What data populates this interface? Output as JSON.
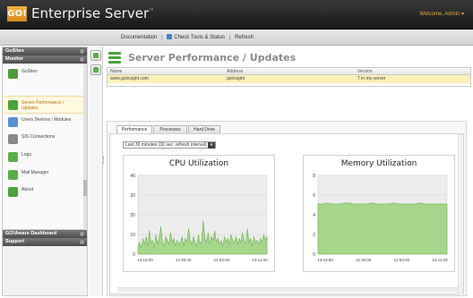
{
  "app": {
    "logo": "GO!",
    "title": "Enterprise Server",
    "tm": "™",
    "welcome": "Welcome, Admin ▾"
  },
  "toolbar": {
    "items": [
      "Documentation",
      "Check Tools & Status",
      "Refresh"
    ]
  },
  "sidebar": {
    "sections": [
      {
        "label": "GoSites",
        "items": []
      },
      {
        "label": "Monitor"
      },
      {
        "label": "GO!Aware Dashboard"
      },
      {
        "label": "Support"
      }
    ],
    "items": [
      {
        "label": "GoSites",
        "icon": "server-icon",
        "color": "#4f9b3b"
      },
      {
        "label": "Server Performance / Updates",
        "icon": "chart-icon",
        "color": "#4aa33b"
      },
      {
        "label": "Users Devices / Modules",
        "icon": "users-icon",
        "color": "#5a8fd0"
      },
      {
        "label": "SIS Connections",
        "icon": "connection-icon",
        "color": "#888888"
      },
      {
        "label": "Logs",
        "icon": "logs-icon",
        "color": "#5cae4b"
      },
      {
        "label": "Mail Manager",
        "icon": "mail-icon",
        "color": "#5cae4b"
      },
      {
        "label": "About",
        "icon": "info-icon",
        "color": "#4aa33b"
      }
    ]
  },
  "page": {
    "title": "Server Performance / Updates"
  },
  "grid": {
    "headers": [
      "Name",
      "Address",
      "Version"
    ],
    "rows": [
      [
        "www.goinsight.com",
        "goinsight",
        "7 in my server"
      ]
    ]
  },
  "tabs": [
    "Performance",
    "Processes",
    "Hard Drive"
  ],
  "range": {
    "value": "Last 30 minutes (30 sec. refresh interval)"
  },
  "colors": {
    "accent": "#4aa33b",
    "chart_fill": "#a6d58c",
    "chart_line": "#6fb352",
    "selected_row": "#fbf0b6"
  },
  "chart_data": [
    {
      "type": "area",
      "title": "CPU Utilization",
      "y_ticks": [
        "40",
        "30",
        "20",
        "10",
        "0"
      ],
      "x_ticks": [
        "12:19:00",
        "12:35:00",
        "12:53:00",
        "13:11:00"
      ],
      "ylim": [
        0,
        40
      ],
      "values": [
        4,
        6,
        3,
        8,
        5,
        9,
        4,
        12,
        6,
        7,
        3,
        10,
        5,
        8,
        14,
        6,
        4,
        9,
        7,
        5,
        11,
        6,
        8,
        4,
        7,
        5,
        6,
        9,
        4,
        8,
        6,
        13,
        7,
        5,
        9,
        6,
        4,
        10,
        5,
        7,
        17,
        8,
        6,
        11,
        5,
        9,
        7,
        12,
        6,
        8,
        5,
        7,
        4,
        9,
        6,
        8,
        5,
        10,
        7,
        6,
        9,
        5,
        8,
        6,
        11,
        7,
        5,
        13,
        6,
        8,
        4,
        9,
        6,
        7,
        5,
        8,
        6,
        10,
        7,
        9
      ]
    },
    {
      "type": "area",
      "title": "Memory Utilization",
      "y_ticks": [
        "8",
        "6",
        "4",
        "2",
        "0"
      ],
      "x_ticks": [
        "12:19:00",
        "12:35:00",
        "12:53:00",
        "13:11:00"
      ],
      "ylim": [
        0,
        8
      ],
      "values": [
        5.1,
        5.1,
        5.2,
        5.1,
        5.1,
        5.1,
        5.2,
        5.2,
        5.1,
        5.1,
        5.1,
        5.1,
        5.2,
        5.1,
        5.1,
        5.1,
        5.1,
        5.2,
        5.1,
        5.1,
        5.1,
        5.1,
        5.1,
        5.2,
        5.1,
        5.1,
        5.1,
        5.1,
        5.1,
        5.1
      ]
    }
  ]
}
